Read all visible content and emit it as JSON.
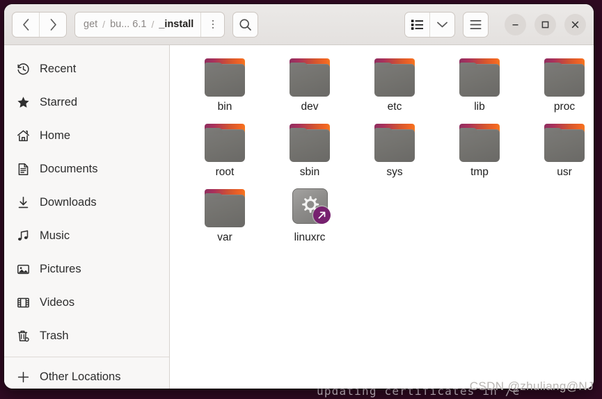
{
  "window": {
    "title": "_install",
    "controls": {
      "minimize_label": "–",
      "maximize_label": "□",
      "close_label": "×"
    }
  },
  "header": {
    "back_label": "‹",
    "forward_label": "›",
    "breadcrumb": [
      {
        "label": "get",
        "current": false
      },
      {
        "label": "bu... 6.1",
        "current": false
      },
      {
        "label": "_install",
        "current": true
      }
    ],
    "separator": "/",
    "path_menu_label": "",
    "search_label": "",
    "view_toggle_label": "",
    "view_dropdown_label": "",
    "main_menu_label": ""
  },
  "sidebar": {
    "items": [
      {
        "label": "Recent",
        "icon": "clock-icon"
      },
      {
        "label": "Starred",
        "icon": "star-icon"
      },
      {
        "label": "Home",
        "icon": "home-icon"
      },
      {
        "label": "Documents",
        "icon": "document-icon"
      },
      {
        "label": "Downloads",
        "icon": "download-icon"
      },
      {
        "label": "Music",
        "icon": "music-note-icon"
      },
      {
        "label": "Pictures",
        "icon": "picture-icon"
      },
      {
        "label": "Videos",
        "icon": "film-icon"
      },
      {
        "label": "Trash",
        "icon": "trash-icon"
      }
    ],
    "other_locations": {
      "label": "Other Locations",
      "icon": "plus-icon"
    }
  },
  "files": [
    {
      "name": "bin",
      "type": "folder"
    },
    {
      "name": "dev",
      "type": "folder"
    },
    {
      "name": "etc",
      "type": "folder"
    },
    {
      "name": "lib",
      "type": "folder"
    },
    {
      "name": "proc",
      "type": "folder"
    },
    {
      "name": "root",
      "type": "folder"
    },
    {
      "name": "sbin",
      "type": "folder"
    },
    {
      "name": "sys",
      "type": "folder"
    },
    {
      "name": "tmp",
      "type": "folder"
    },
    {
      "name": "usr",
      "type": "folder"
    },
    {
      "name": "var",
      "type": "folder"
    },
    {
      "name": "linuxrc",
      "type": "executable-symlink"
    }
  ],
  "background": {
    "terminal_text": "updating certificates in /e"
  },
  "watermark": "CSDN @zhuliang@NJ",
  "colors": {
    "folder_tab_start": "#8e2f5f",
    "folder_tab_end": "#f47b20",
    "folder_body": "#74736f",
    "symlink_badge": "#77216f",
    "headerbar": "#e6e4e1",
    "sidebar": "#f8f7f6",
    "terminal_bg": "#300a22"
  }
}
